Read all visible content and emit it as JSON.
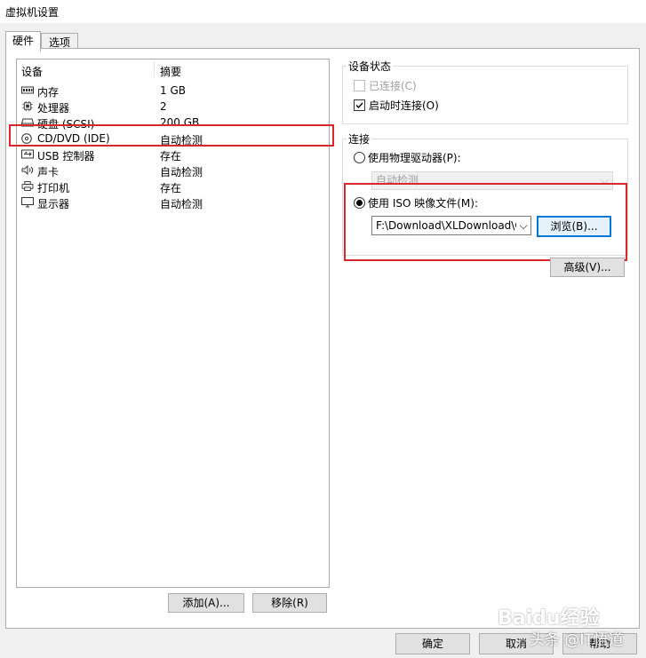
{
  "window": {
    "title": "虚拟机设置"
  },
  "tabs": [
    {
      "label": "硬件",
      "active": true
    },
    {
      "label": "选项",
      "active": false
    }
  ],
  "device_list": {
    "columns": [
      "设备",
      "摘要"
    ],
    "rows": [
      {
        "icon": "memory-icon",
        "name": "内存",
        "summary": "1 GB"
      },
      {
        "icon": "cpu-icon",
        "name": "处理器",
        "summary": "2"
      },
      {
        "icon": "harddisk-icon",
        "name": "硬盘 (SCSI)",
        "summary": "200 GB"
      },
      {
        "icon": "cd-icon",
        "name": "CD/DVD (IDE)",
        "summary": "自动检测",
        "selected": true
      },
      {
        "icon": "usb-icon",
        "name": "USB 控制器",
        "summary": "存在"
      },
      {
        "icon": "sound-icon",
        "name": "声卡",
        "summary": "自动检测"
      },
      {
        "icon": "printer-icon",
        "name": "打印机",
        "summary": "存在"
      },
      {
        "icon": "monitor-icon",
        "name": "显示器",
        "summary": "自动检测"
      }
    ]
  },
  "list_buttons": {
    "add": "添加(A)...",
    "remove": "移除(R)"
  },
  "device_status": {
    "title": "设备状态",
    "connected": {
      "label": "已连接(C)",
      "checked": false,
      "enabled": false
    },
    "connect_at_power_on": {
      "label": "启动时连接(O)",
      "checked": true
    }
  },
  "connection": {
    "title": "连接",
    "physical": {
      "label": "使用物理驱动器(P):",
      "selected": false,
      "drive_value": "自动检测"
    },
    "iso": {
      "label": "使用 ISO 映像文件(M):",
      "selected": true,
      "path": "F:\\Download\\XLDownload\\C"
    },
    "browse": "浏览(B)...",
    "advanced": "高级(V)..."
  },
  "footer": {
    "ok": "确定",
    "cancel": "取消",
    "help": "帮助"
  },
  "watermarks": {
    "baidu": "Baidu经验",
    "toutiao": "头条 @IT悟道"
  },
  "colors": {
    "highlight_red": "#d9272e",
    "focus_blue": "#0078d7"
  }
}
